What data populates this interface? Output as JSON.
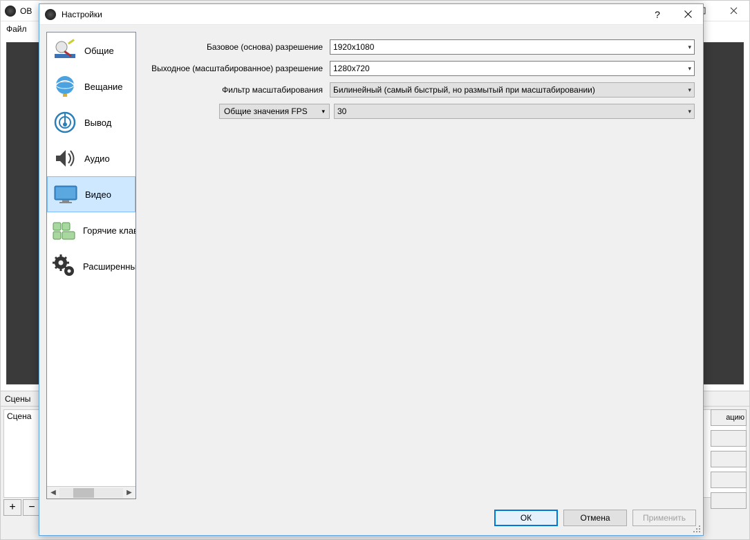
{
  "back": {
    "title": "OB",
    "menu_file": "Файл",
    "scenes_header": "Сцены",
    "scene_item": "Сцена",
    "add_symbol": "+",
    "remove_symbol": "−",
    "right_button_text": "ацию"
  },
  "dialog": {
    "title": "Настройки",
    "help_symbol": "?",
    "buttons": {
      "ok": "ОК",
      "cancel": "Отмена",
      "apply": "Применить"
    }
  },
  "sidebar": {
    "items": [
      {
        "label": "Общие"
      },
      {
        "label": "Вещание"
      },
      {
        "label": "Вывод"
      },
      {
        "label": "Аудио"
      },
      {
        "label": "Видео"
      },
      {
        "label": "Горячие клавиши"
      },
      {
        "label": "Расширенные"
      }
    ],
    "selected_index": 4
  },
  "form": {
    "base_resolution": {
      "label": "Базовое (основа) разрешение",
      "value": "1920x1080"
    },
    "scaled_resolution": {
      "label": "Выходное (масштабированное) разрешение",
      "value": "1280x720"
    },
    "downscale_filter": {
      "label": "Фильтр масштабирования",
      "value": "Билинейный (самый быстрый, но размытый при масштабировании)"
    },
    "fps": {
      "type_label": "Общие значения FPS",
      "value": "30"
    }
  }
}
